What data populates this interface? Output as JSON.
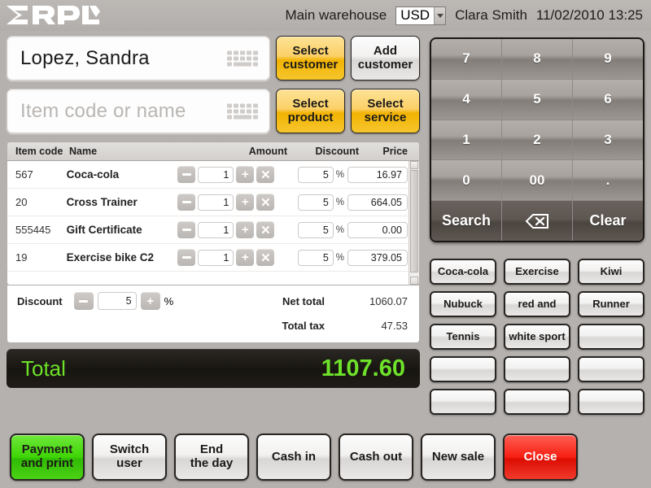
{
  "header": {
    "logo_text": "ERPLY",
    "warehouse": "Main warehouse",
    "currency": "USD",
    "user": "Clara Smith",
    "datetime": "11/02/2010 13:25"
  },
  "entry": {
    "customer_value": "Lopez, Sandra",
    "item_placeholder": "Item code or name",
    "select_customer": "Select\ncustomer",
    "add_customer": "Add\ncustomer",
    "select_product": "Select\nproduct",
    "select_service": "Select\nservice"
  },
  "table": {
    "headers": {
      "code": "Item code",
      "name": "Name",
      "amount": "Amount",
      "discount": "Discount",
      "price": "Price"
    },
    "percent_symbol": "%",
    "rows": [
      {
        "code": "567",
        "name": "Coca-cola",
        "amount": "1",
        "discount": "5",
        "price": "16.97"
      },
      {
        "code": "20",
        "name": "Cross Trainer",
        "amount": "1",
        "discount": "5",
        "price": "664.05"
      },
      {
        "code": "555445",
        "name": "Gift Certificate",
        "amount": "1",
        "discount": "5",
        "price": "0.00"
      },
      {
        "code": "19",
        "name": "Exercise bike C2",
        "amount": "1",
        "discount": "5",
        "price": "379.05"
      }
    ]
  },
  "totals": {
    "discount_label": "Discount",
    "discount_value": "5",
    "percent_symbol": "%",
    "net_total_label": "Net total",
    "net_total_value": "1060.07",
    "total_tax_label": "Total tax",
    "total_tax_value": "47.53",
    "total_label": "Total",
    "total_value": "1107.60",
    "total_color": "#6ee22a"
  },
  "keypad": {
    "keys": [
      "7",
      "8",
      "9",
      "4",
      "5",
      "6",
      "1",
      "2",
      "3",
      "0",
      "00",
      "."
    ],
    "search_label": "Search",
    "backspace_label": "backspace-icon",
    "clear_label": "Clear"
  },
  "quick_buttons": [
    "Coca-cola",
    "Exercise",
    "Kiwi",
    "Nubuck",
    "red and",
    "Runner",
    "Tennis",
    "white sport",
    "",
    "",
    "",
    "",
    "",
    "",
    ""
  ],
  "bottom_bar": [
    {
      "label": "Payment\nand print",
      "style": "green"
    },
    {
      "label": "Switch\nuser",
      "style": "grey"
    },
    {
      "label": "End\nthe day",
      "style": "grey"
    },
    {
      "label": "Cash in",
      "style": "grey"
    },
    {
      "label": "Cash out",
      "style": "grey"
    },
    {
      "label": "New sale",
      "style": "grey"
    },
    {
      "label": "Close",
      "style": "red"
    }
  ]
}
